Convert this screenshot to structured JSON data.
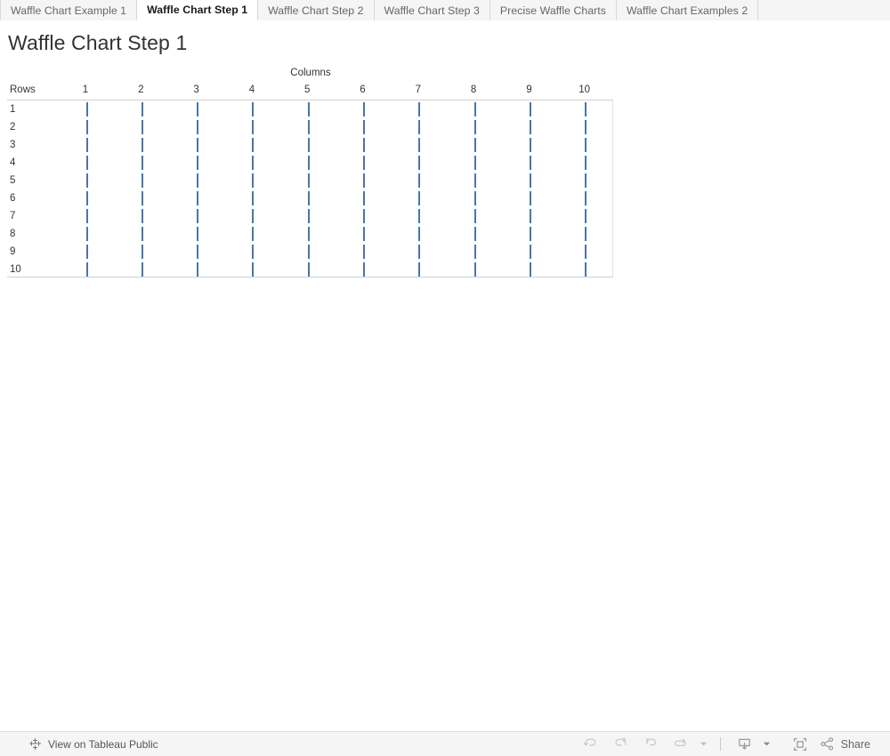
{
  "tabs": [
    {
      "label": "Waffle Chart Example 1",
      "active": false
    },
    {
      "label": "Waffle Chart Step 1",
      "active": true
    },
    {
      "label": "Waffle Chart Step 2",
      "active": false
    },
    {
      "label": "Waffle Chart Step 3",
      "active": false
    },
    {
      "label": "Precise Waffle Charts",
      "active": false
    },
    {
      "label": "Waffle Chart Examples 2",
      "active": false
    }
  ],
  "viz": {
    "title": "Waffle Chart Step 1"
  },
  "toolbar": {
    "tableau_public_label": "View on Tableau Public",
    "tableau_icon": "tableau-logo-icon",
    "undo_icon": "undo-icon",
    "redo_icon": "redo-icon",
    "revert_icon": "revert-icon",
    "refresh_icon": "refresh-icon",
    "refresh_caret_icon": "chevron-down-icon",
    "download_icon": "download-icon",
    "download_caret_icon": "chevron-down-icon",
    "fullscreen_icon": "fullscreen-icon",
    "share_icon": "share-icon",
    "share_label": "Share"
  },
  "chart_data": {
    "type": "heatmap",
    "title": "Waffle Chart Step 1",
    "xlabel": "Columns",
    "ylabel": "Rows",
    "columns": [
      "1",
      "2",
      "3",
      "4",
      "5",
      "6",
      "7",
      "8",
      "9",
      "10"
    ],
    "rows": [
      "1",
      "2",
      "3",
      "4",
      "5",
      "6",
      "7",
      "8",
      "9",
      "10"
    ],
    "mark_color": "#4a76a8",
    "mark_type": "thin-vertical-bar",
    "grid": true,
    "legend": "none",
    "values": [
      [
        1,
        1,
        1,
        1,
        1,
        1,
        1,
        1,
        1,
        1
      ],
      [
        1,
        1,
        1,
        1,
        1,
        1,
        1,
        1,
        1,
        1
      ],
      [
        1,
        1,
        1,
        1,
        1,
        1,
        1,
        1,
        1,
        1
      ],
      [
        1,
        1,
        1,
        1,
        1,
        1,
        1,
        1,
        1,
        1
      ],
      [
        1,
        1,
        1,
        1,
        1,
        1,
        1,
        1,
        1,
        1
      ],
      [
        1,
        1,
        1,
        1,
        1,
        1,
        1,
        1,
        1,
        1
      ],
      [
        1,
        1,
        1,
        1,
        1,
        1,
        1,
        1,
        1,
        1
      ],
      [
        1,
        1,
        1,
        1,
        1,
        1,
        1,
        1,
        1,
        1
      ],
      [
        1,
        1,
        1,
        1,
        1,
        1,
        1,
        1,
        1,
        1
      ],
      [
        1,
        1,
        1,
        1,
        1,
        1,
        1,
        1,
        1,
        1
      ]
    ]
  }
}
